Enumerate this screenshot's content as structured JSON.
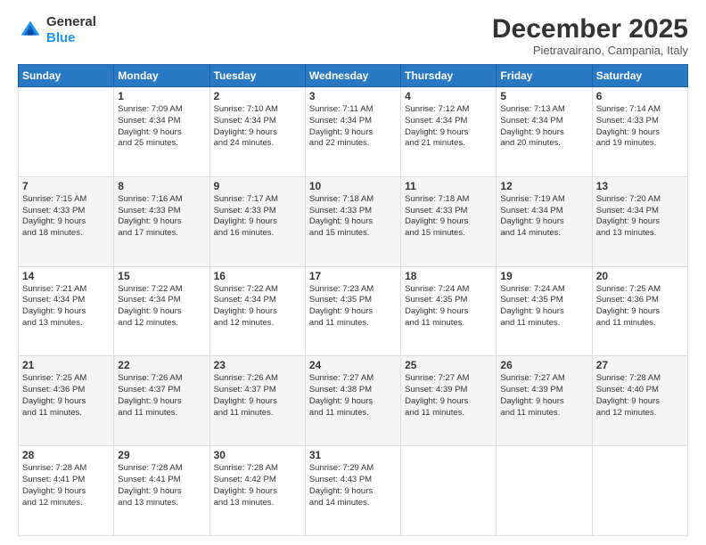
{
  "logo": {
    "general": "General",
    "blue": "Blue"
  },
  "header": {
    "month": "December 2025",
    "location": "Pietravairano, Campania, Italy"
  },
  "days_of_week": [
    "Sunday",
    "Monday",
    "Tuesday",
    "Wednesday",
    "Thursday",
    "Friday",
    "Saturday"
  ],
  "weeks": [
    [
      {
        "day": "",
        "info": ""
      },
      {
        "day": "1",
        "info": "Sunrise: 7:09 AM\nSunset: 4:34 PM\nDaylight: 9 hours\nand 25 minutes."
      },
      {
        "day": "2",
        "info": "Sunrise: 7:10 AM\nSunset: 4:34 PM\nDaylight: 9 hours\nand 24 minutes."
      },
      {
        "day": "3",
        "info": "Sunrise: 7:11 AM\nSunset: 4:34 PM\nDaylight: 9 hours\nand 22 minutes."
      },
      {
        "day": "4",
        "info": "Sunrise: 7:12 AM\nSunset: 4:34 PM\nDaylight: 9 hours\nand 21 minutes."
      },
      {
        "day": "5",
        "info": "Sunrise: 7:13 AM\nSunset: 4:34 PM\nDaylight: 9 hours\nand 20 minutes."
      },
      {
        "day": "6",
        "info": "Sunrise: 7:14 AM\nSunset: 4:33 PM\nDaylight: 9 hours\nand 19 minutes."
      }
    ],
    [
      {
        "day": "7",
        "info": "Sunrise: 7:15 AM\nSunset: 4:33 PM\nDaylight: 9 hours\nand 18 minutes."
      },
      {
        "day": "8",
        "info": "Sunrise: 7:16 AM\nSunset: 4:33 PM\nDaylight: 9 hours\nand 17 minutes."
      },
      {
        "day": "9",
        "info": "Sunrise: 7:17 AM\nSunset: 4:33 PM\nDaylight: 9 hours\nand 16 minutes."
      },
      {
        "day": "10",
        "info": "Sunrise: 7:18 AM\nSunset: 4:33 PM\nDaylight: 9 hours\nand 15 minutes."
      },
      {
        "day": "11",
        "info": "Sunrise: 7:18 AM\nSunset: 4:33 PM\nDaylight: 9 hours\nand 15 minutes."
      },
      {
        "day": "12",
        "info": "Sunrise: 7:19 AM\nSunset: 4:34 PM\nDaylight: 9 hours\nand 14 minutes."
      },
      {
        "day": "13",
        "info": "Sunrise: 7:20 AM\nSunset: 4:34 PM\nDaylight: 9 hours\nand 13 minutes."
      }
    ],
    [
      {
        "day": "14",
        "info": "Sunrise: 7:21 AM\nSunset: 4:34 PM\nDaylight: 9 hours\nand 13 minutes."
      },
      {
        "day": "15",
        "info": "Sunrise: 7:22 AM\nSunset: 4:34 PM\nDaylight: 9 hours\nand 12 minutes."
      },
      {
        "day": "16",
        "info": "Sunrise: 7:22 AM\nSunset: 4:34 PM\nDaylight: 9 hours\nand 12 minutes."
      },
      {
        "day": "17",
        "info": "Sunrise: 7:23 AM\nSunset: 4:35 PM\nDaylight: 9 hours\nand 11 minutes."
      },
      {
        "day": "18",
        "info": "Sunrise: 7:24 AM\nSunset: 4:35 PM\nDaylight: 9 hours\nand 11 minutes."
      },
      {
        "day": "19",
        "info": "Sunrise: 7:24 AM\nSunset: 4:35 PM\nDaylight: 9 hours\nand 11 minutes."
      },
      {
        "day": "20",
        "info": "Sunrise: 7:25 AM\nSunset: 4:36 PM\nDaylight: 9 hours\nand 11 minutes."
      }
    ],
    [
      {
        "day": "21",
        "info": "Sunrise: 7:25 AM\nSunset: 4:36 PM\nDaylight: 9 hours\nand 11 minutes."
      },
      {
        "day": "22",
        "info": "Sunrise: 7:26 AM\nSunset: 4:37 PM\nDaylight: 9 hours\nand 11 minutes."
      },
      {
        "day": "23",
        "info": "Sunrise: 7:26 AM\nSunset: 4:37 PM\nDaylight: 9 hours\nand 11 minutes."
      },
      {
        "day": "24",
        "info": "Sunrise: 7:27 AM\nSunset: 4:38 PM\nDaylight: 9 hours\nand 11 minutes."
      },
      {
        "day": "25",
        "info": "Sunrise: 7:27 AM\nSunset: 4:39 PM\nDaylight: 9 hours\nand 11 minutes."
      },
      {
        "day": "26",
        "info": "Sunrise: 7:27 AM\nSunset: 4:39 PM\nDaylight: 9 hours\nand 11 minutes."
      },
      {
        "day": "27",
        "info": "Sunrise: 7:28 AM\nSunset: 4:40 PM\nDaylight: 9 hours\nand 12 minutes."
      }
    ],
    [
      {
        "day": "28",
        "info": "Sunrise: 7:28 AM\nSunset: 4:41 PM\nDaylight: 9 hours\nand 12 minutes."
      },
      {
        "day": "29",
        "info": "Sunrise: 7:28 AM\nSunset: 4:41 PM\nDaylight: 9 hours\nand 13 minutes."
      },
      {
        "day": "30",
        "info": "Sunrise: 7:28 AM\nSunset: 4:42 PM\nDaylight: 9 hours\nand 13 minutes."
      },
      {
        "day": "31",
        "info": "Sunrise: 7:29 AM\nSunset: 4:43 PM\nDaylight: 9 hours\nand 14 minutes."
      },
      {
        "day": "",
        "info": ""
      },
      {
        "day": "",
        "info": ""
      },
      {
        "day": "",
        "info": ""
      }
    ]
  ]
}
